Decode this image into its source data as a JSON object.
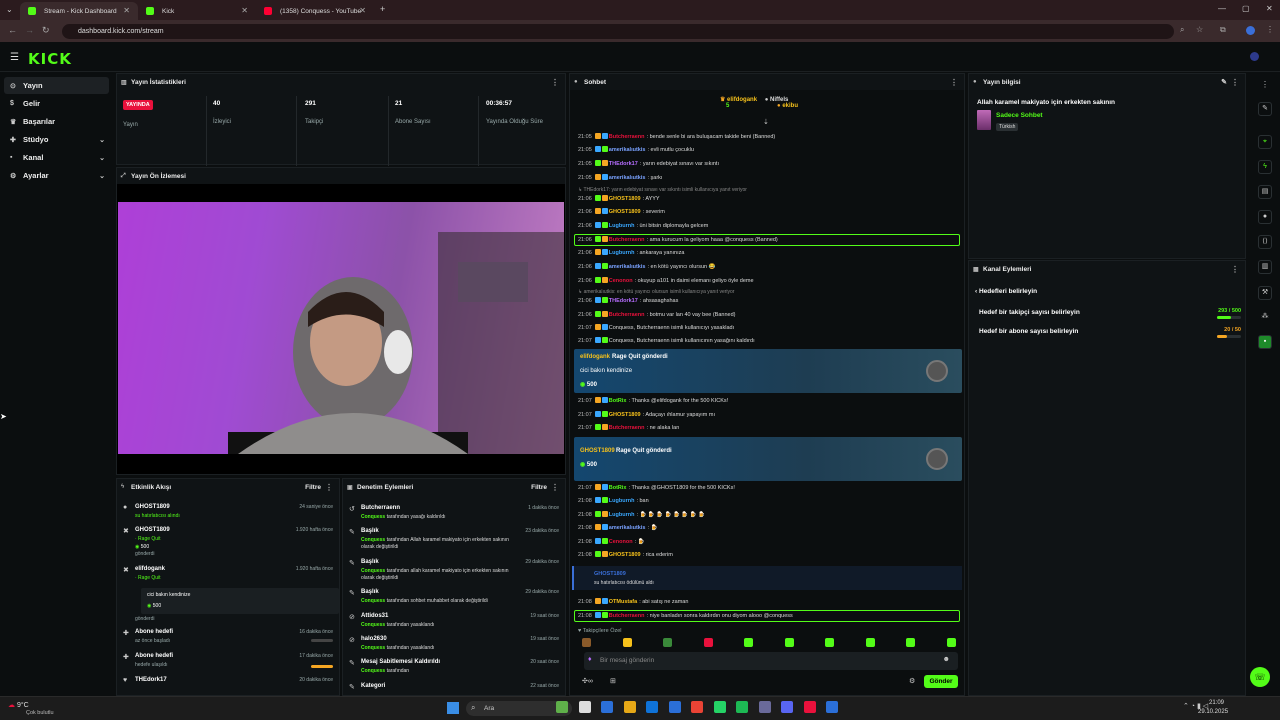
{
  "browser": {
    "tabs": [
      {
        "label": "Stream - Kick Dashboard",
        "color": "#53fc18"
      },
      {
        "label": "Kick",
        "color": "#53fc18"
      },
      {
        "label": "(1358) Conquess - YouTube",
        "color": "#ff0033"
      }
    ],
    "url": "dashboard.kick.com/stream"
  },
  "sidebar": {
    "items": [
      {
        "label": "Yayın",
        "icon": "broadcast-icon"
      },
      {
        "label": "Gelir",
        "icon": "dollar-icon"
      },
      {
        "label": "Başarılar",
        "icon": "trophy-icon"
      },
      {
        "label": "Stüdyo",
        "icon": "studio-icon"
      },
      {
        "label": "Kanal",
        "icon": "channel-icon"
      },
      {
        "label": "Ayarlar",
        "icon": "gear-icon"
      }
    ]
  },
  "stats": {
    "title": "Yayın İstatistikleri",
    "live_badge": "YAYINDA",
    "items": [
      {
        "value": "",
        "label": "Yayın"
      },
      {
        "value": "40",
        "label": "İzleyici"
      },
      {
        "value": "291",
        "label": "Takipçi"
      },
      {
        "value": "21",
        "label": "Abone Sayısı"
      },
      {
        "value": "00:36:57",
        "label": "Yayında Olduğu Süre"
      }
    ]
  },
  "preview": {
    "title": "Yayın Ön İzlemesi"
  },
  "activity": {
    "title": "Etkinlik Akışı",
    "filter": "Filtre",
    "rows": [
      {
        "name": "GHOST1809",
        "sub": "su hatırlatıcısı alındı",
        "time": "24 saniye önce",
        "icon": "●"
      },
      {
        "name": "GHOST1809",
        "sub": "· Rage Quit",
        "extra": "500",
        "extra2": "gönderdi",
        "time": "1.920 hafta önce",
        "icon": "✖"
      },
      {
        "name": "elifdogank",
        "sub": "· Rage Quit",
        "msg": "cici bakın kendinize",
        "extra": "500",
        "extra2": "gönderdi",
        "time": "1.920 hafta önce",
        "icon": "✖"
      },
      {
        "name": "Abone hedefi",
        "sub": "az önce başladı",
        "time": "16 dakika önce",
        "icon": "✚"
      },
      {
        "name": "Abone hedefi",
        "sub": "hedefe ulaşıldı",
        "time": "17 dakika önce",
        "icon": "✚"
      },
      {
        "name": "THEdork17",
        "sub": "",
        "time": "20 dakika önce",
        "icon": "♥"
      }
    ]
  },
  "moderation": {
    "title": "Denetim Eylemleri",
    "filter": "Filtre",
    "rows": [
      {
        "name": "Butcherraenn",
        "actor": "Conquess",
        "text": "tarafından yasağı kaldırıldı",
        "time": "1 dakika önce"
      },
      {
        "name": "Başlık",
        "actor": "Conquess",
        "text": "tarafından Allah karamel makiyato için erkekten sakının olarak değiştirildi",
        "time": "23 dakika önce"
      },
      {
        "name": "Başlık",
        "actor": "Conquess",
        "text": "tarafından allah karamel makiyato için erkekten sakının olarak değiştirildi",
        "time": "29 dakika önce"
      },
      {
        "name": "Başlık",
        "actor": "Conquess",
        "text": "tarafından sohbet muhabbet olarak değiştirildi",
        "time": "29 dakika önce"
      },
      {
        "name": "Attidos31",
        "actor": "Conquess",
        "text": "tarafından yasaklandı",
        "time": "19 saat önce"
      },
      {
        "name": "halo2630",
        "actor": "Conquess",
        "text": "tarafından yasaklandı",
        "time": "19 saat önce"
      },
      {
        "name": "Mesaj Sabitlemesi Kaldırıldı",
        "actor": "Conquess",
        "text": "tarafından",
        "time": "20 saat önce"
      },
      {
        "name": "Kategori",
        "actor": "",
        "text": "",
        "time": "22 saat önce"
      }
    ]
  },
  "chat": {
    "title": "Sohbet",
    "pinned": [
      {
        "name": "elifdogank",
        "count": "5"
      },
      {
        "name": "Niffels",
        "count": "1"
      },
      {
        "name": "ekibu",
        "count": "1"
      }
    ],
    "lines": [
      {
        "t": "21:05",
        "u": "Butcherraenn",
        "c": "#e9113c",
        "m": ": bende senle bi ara buluşacam takide beni (Banned)"
      },
      {
        "t": "21:05",
        "u": "amerikalıutkis",
        "c": "#7aa2ff",
        "m": ": evli mutlu çocuklu"
      },
      {
        "t": "21:05",
        "u": "THEdork17",
        "c": "#b66dff",
        "m": ": yarın edebiyat sınavı var sıkıntı"
      },
      {
        "t": "21:05",
        "u": "amerikalıutkis",
        "c": "#7aa2ff",
        "m": ": şarkı"
      },
      {
        "t": "",
        "u": "",
        "c": "#888",
        "m": "↳ THEdork17: yarın edebiyat sınavı var sıkıntı isimli kullanıcıya yanıt veriyor"
      },
      {
        "t": "21:06",
        "u": "GHOST1809",
        "c": "#f6c11b",
        "m": ": AYYY"
      },
      {
        "t": "21:06",
        "u": "GHOST1809",
        "c": "#f6c11b",
        "m": ": severim"
      },
      {
        "t": "21:06",
        "u": "Lugburnh",
        "c": "#3aa8ff",
        "m": ": üni bitsin diplomayla gelcem"
      },
      {
        "t": "21:06",
        "u": "Butcherraenn",
        "c": "#e9113c",
        "m": ": ama kurucum la geliyom haaa @conquess (Banned)"
      },
      {
        "t": "21:06",
        "u": "Lugburnh",
        "c": "#3aa8ff",
        "m": ": ankaraya yanınıza"
      },
      {
        "t": "21:06",
        "u": "amerikalıutkis",
        "c": "#7aa2ff",
        "m": ": en kötü yayıncı olursun 😂"
      },
      {
        "t": "21:06",
        "u": "Cenonon",
        "c": "#e9113c",
        "m": ": okuyup a101 in daimi elemanı geliyo öyle deme"
      },
      {
        "t": "",
        "u": "",
        "c": "#888",
        "m": "↳ amerikalıutkis: en kötü yayıncı olursun isimli kullanıcıya yanıt veriyor"
      },
      {
        "t": "21:06",
        "u": "THEdork17",
        "c": "#b66dff",
        "m": ": ahsasaghshas"
      },
      {
        "t": "21:06",
        "u": "Butcherraenn",
        "c": "#e9113c",
        "m": ": botmu var lan 40 vay bee (Banned)"
      },
      {
        "t": "21:07",
        "u": "",
        "c": "#ccc",
        "m": "Conquess, Butcherraenn isimli kullanıcıyı yasakladı"
      },
      {
        "t": "21:07",
        "u": "",
        "c": "#ccc",
        "m": "Conquess, Butcherraenn isimli kullanıcının yasağını kaldırdı"
      }
    ],
    "gift1": {
      "user": "elifdogank",
      "text": "Rage Quit gönderdi",
      "msg": "cici bakın kendinize",
      "amount": "500"
    },
    "lines2": [
      {
        "t": "21:07",
        "u": "BotRix",
        "c": "#53fc18",
        "m": ": Thanks @elifdogank for the 500 KICKs!"
      },
      {
        "t": "21:07",
        "u": "GHOST1809",
        "c": "#f6c11b",
        "m": ": Adaçayı ıhlamur yapayım mı"
      },
      {
        "t": "21:07",
        "u": "Butcherraenn",
        "c": "#e9113c",
        "m": ": ne alaka lan"
      }
    ],
    "gift2": {
      "user": "GHOST1809",
      "text": "Rage Quit gönderdi",
      "amount": "500"
    },
    "lines3": [
      {
        "t": "21:07",
        "u": "BotRix",
        "c": "#53fc18",
        "m": ": Thanks @GHOST1809 for the 500 KICKs!"
      },
      {
        "t": "21:08",
        "u": "Lugburnh",
        "c": "#3aa8ff",
        "m": ": ban"
      },
      {
        "t": "21:08",
        "u": "Lugburnh",
        "c": "#3aa8ff",
        "m": ": 🍺 🍺 🍺 🍺 🍺 🍺 🍺 🍺"
      },
      {
        "t": "21:08",
        "u": "amerikalıutkis",
        "c": "#7aa2ff",
        "m": ": 🍺"
      },
      {
        "t": "21:08",
        "u": "Cenonon",
        "c": "#e9113c",
        "m": ": 🍺"
      },
      {
        "t": "21:08",
        "u": "GHOST1809",
        "c": "#f6c11b",
        "m": ": rica ederim"
      }
    ],
    "reminder": {
      "user": "GHOST1809",
      "text": "su hatırlatıcısı ödülünü aldı"
    },
    "lines4": [
      {
        "t": "21:08",
        "u": "OTMustafa",
        "c": "#f6c11b",
        "m": ": abi satış ne zaman"
      },
      {
        "t": "21:08",
        "u": "Butcherraenn",
        "c": "#e9113c",
        "m": ": niye banladın sonra kaldırdın onu diyom alooo @conquess"
      }
    ],
    "followers_only": "Takipçilere Özel",
    "input_placeholder": "Bir mesaj gönderin",
    "send": "Gönder"
  },
  "stream_info": {
    "title": "Yayın bilgisi",
    "stream_title": "Allah karamel makiyato için erkekten sakının",
    "category": "Sadece Sohbet",
    "language": "Türkish"
  },
  "channel_actions": {
    "title": "Kanal Eylemleri",
    "back": "Hedefleri belirleyin",
    "goals": [
      {
        "label": "Hedef bir takipçi sayısı belirleyin",
        "value": "293 / 500",
        "progress": 0.586,
        "color": "#53fc18"
      },
      {
        "label": "Hedef bir abone sayısı belirleyin",
        "value": "20 / 50",
        "progress": 0.4,
        "color": "#f5a623"
      }
    ]
  },
  "taskbar": {
    "weather": "9°C",
    "weather_desc": "Çok bulutlu",
    "search": "Ara",
    "time": "21:09",
    "date": "29.10.2025"
  }
}
